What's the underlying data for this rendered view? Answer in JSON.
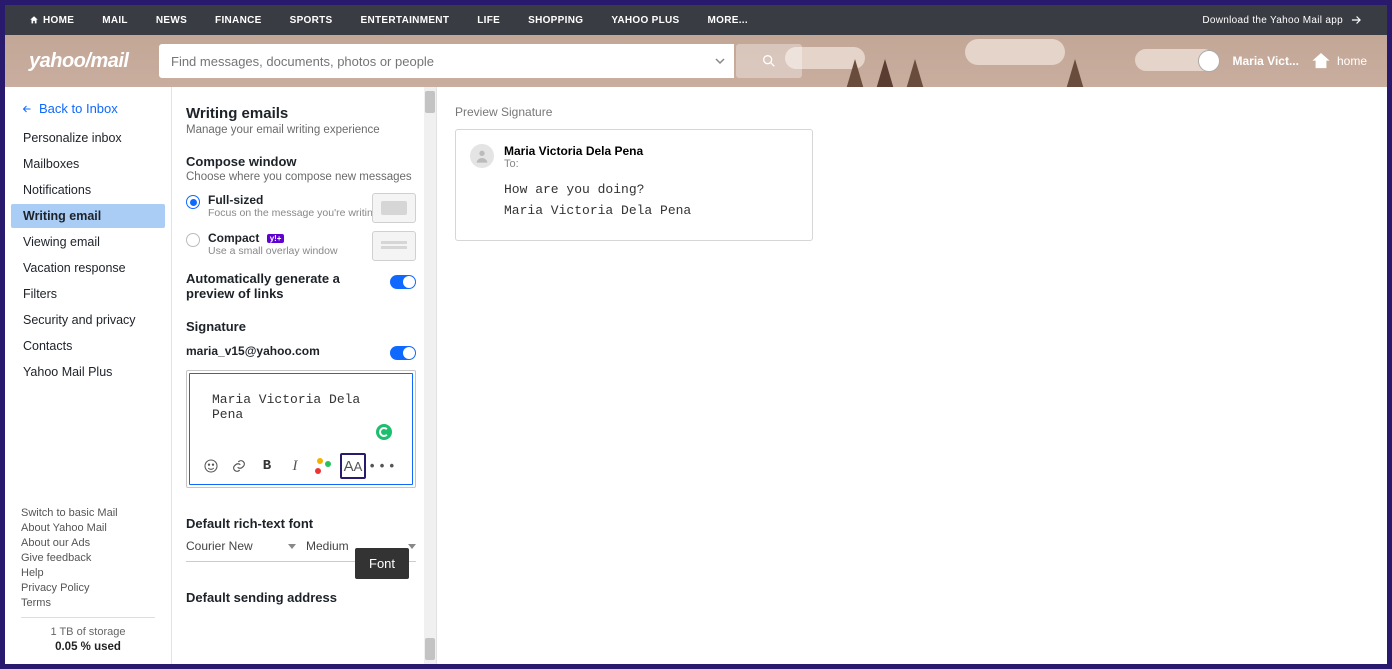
{
  "globalNav": {
    "items": [
      "HOME",
      "MAIL",
      "NEWS",
      "FINANCE",
      "SPORTS",
      "ENTERTAINMENT",
      "LIFE",
      "SHOPPING",
      "YAHOO PLUS",
      "MORE..."
    ],
    "download": "Download the Yahoo Mail app"
  },
  "masthead": {
    "logo_pre": "yahoo",
    "logo_post": "mail",
    "search_placeholder": "Find messages, documents, photos or people",
    "user_name": "Maria Vict...",
    "home_label": "home"
  },
  "sidebar": {
    "back": "Back to Inbox",
    "items": [
      "Personalize inbox",
      "Mailboxes",
      "Notifications",
      "Writing email",
      "Viewing email",
      "Vacation response",
      "Filters",
      "Security and privacy",
      "Contacts",
      "Yahoo Mail Plus"
    ],
    "active_index": 3,
    "footer": [
      "Switch to basic Mail",
      "About Yahoo Mail",
      "About our Ads",
      "Give feedback",
      "Help",
      "Privacy Policy",
      "Terms"
    ],
    "storage_line1": "1 TB of storage",
    "storage_line2": "0.05 % used"
  },
  "settings": {
    "title": "Writing emails",
    "subtitle": "Manage your email writing experience",
    "compose": {
      "heading": "Compose window",
      "sub": "Choose where you compose new messages",
      "opt1_label": "Full-sized",
      "opt1_desc": "Focus on the message you're writing",
      "opt2_label": "Compact",
      "opt2_desc": "Use a small overlay window",
      "yplus": "y!+"
    },
    "auto_preview_label": "Automatically generate a preview of links",
    "signature_heading": "Signature",
    "signature_account": "maria_v15@yahoo.com",
    "signature_text": "Maria Victoria Dela Pena",
    "tooltip": "Font",
    "default_font_heading": "Default rich-text font",
    "font_face": "Courier New",
    "font_size": "Medium",
    "default_send_heading": "Default sending address"
  },
  "preview": {
    "heading": "Preview Signature",
    "from": "Maria Victoria Dela Pena",
    "to_label": "To:",
    "body_line1": "How are you doing?",
    "body_line2": "Maria Victoria Dela Pena"
  }
}
